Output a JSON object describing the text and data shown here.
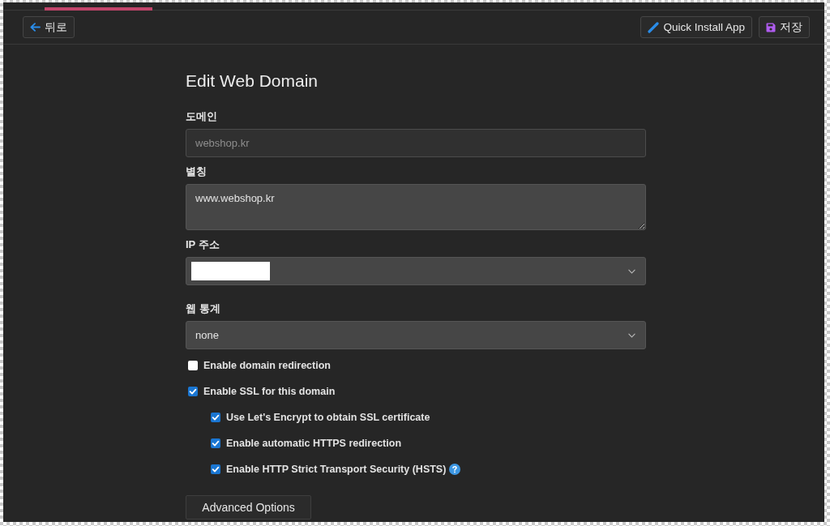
{
  "top_bar": {
    "back_button": "뒤로",
    "quick_install_button": "Quick Install App",
    "save_button": "저장"
  },
  "form": {
    "title": "Edit Web Domain",
    "fields": [
      {
        "kind": "input",
        "label": "도메인",
        "value": "webshop.kr",
        "disabled": true
      },
      {
        "kind": "textarea",
        "label": "별칭",
        "value": "www.webshop.kr",
        "disabled": false
      },
      {
        "kind": "select",
        "label": "IP 주소",
        "redacted": true,
        "disabled": false
      },
      {
        "kind": "select",
        "label": "웹 통계",
        "value": "none",
        "disabled": false
      }
    ],
    "options": [
      {
        "label": "Enable domain redirection",
        "checked": false
      },
      {
        "label": "Enable SSL for this domain",
        "checked": true,
        "children": [
          {
            "label": "Use Let's Encrypt to obtain SSL certificate",
            "checked": true
          },
          {
            "label": "Enable automatic HTTPS redirection",
            "checked": true
          },
          {
            "label": "Enable HTTP Strict Transport Security (HSTS)",
            "checked": true,
            "help": true
          }
        ]
      }
    ],
    "advanced_button": "Advanced Options"
  }
}
